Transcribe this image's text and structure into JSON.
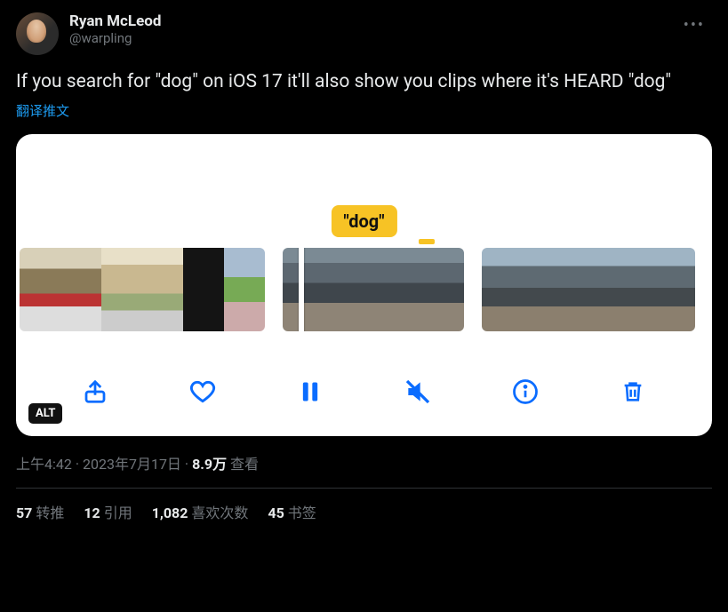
{
  "user": {
    "display_name": "Ryan McLeod",
    "handle": "@warpling"
  },
  "tweet": {
    "text": "If you search for \"dog\" on iOS 17 it'll also show you clips where it's HEARD \"dog\"",
    "translate_label": "翻译推文"
  },
  "media": {
    "search_tag": "\"dog\"",
    "alt_badge": "ALT"
  },
  "meta": {
    "time": "上午4:42",
    "separator": " · ",
    "date": "2023年7月17日",
    "views_count": "8.9万",
    "views_label": " 查看"
  },
  "stats": {
    "retweets_count": "57",
    "retweets_label": "转推",
    "quotes_count": "12",
    "quotes_label": "引用",
    "likes_count": "1,082",
    "likes_label": "喜欢次数",
    "bookmarks_count": "45",
    "bookmarks_label": "书签"
  }
}
